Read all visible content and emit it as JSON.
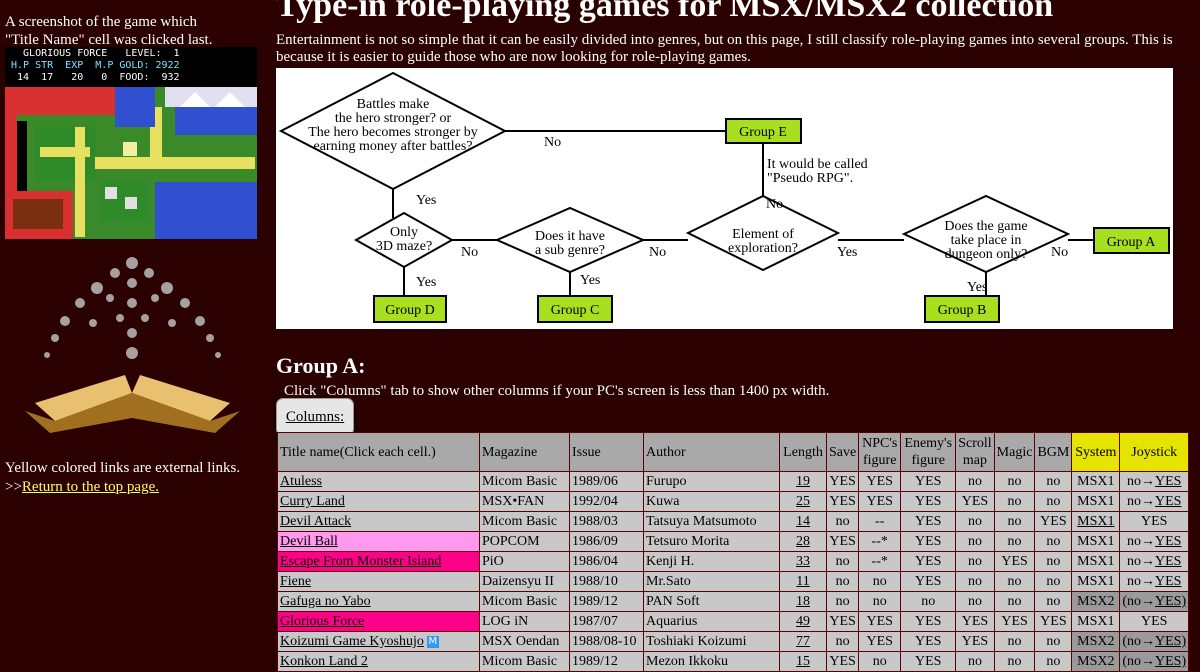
{
  "sidebar": {
    "caption_line1": "A screenshot of the game which",
    "caption_line2": "\"Title Name\" cell was clicked last.",
    "hud": {
      "line1": "  GLORIOUS FORCE   LEVEL:  1",
      "line2": "H.P STR  EXP  M.P GOLD: 2922",
      "line3": " 14  17   20   0  FOOD:  932"
    },
    "yellow_note": "Yellow colored links are external links.",
    "return_prefix": ">>",
    "return_link": "Return to the top page."
  },
  "page": {
    "title": "Type-in role-playing games for MSX/MSX2 collection",
    "intro": "Entertainment is not so simple that it can be easily divided into genres, but on this page, I still classify role-playing games into several groups. This is because it is easier to guide those who are now looking for role-playing games."
  },
  "flowchart": {
    "q1": [
      "Battles make",
      "the hero stronger? or",
      "The hero becomes stronger by",
      "earning money after battles?"
    ],
    "q2": [
      "Only",
      "3D maze?"
    ],
    "q3": [
      "Does it have",
      "a sub genre?"
    ],
    "q4": [
      "Element of",
      "exploration?"
    ],
    "q5": [
      "Does the game",
      "take place in",
      "dungeon only?"
    ],
    "yes": "Yes",
    "no": "No",
    "pseudo_note": [
      "It would be called",
      "\"Pseudo RPG\"."
    ],
    "groups": {
      "a": "Group A",
      "b": "Group B",
      "c": "Group C",
      "d": "Group D",
      "e": "Group E"
    }
  },
  "group_a": {
    "heading": "Group A:",
    "hint": "Click \"Columns\" tab to show other columns if your PC's screen is less than 1400 px width.",
    "columns_button": "Columns:"
  },
  "table": {
    "headers": {
      "title": "Title name(Click each cell.)",
      "magazine": "Magazine",
      "issue": "Issue",
      "author": "Author",
      "length": "Length",
      "save": "Save",
      "npc": "NPC's figure",
      "enemy": "Enemy's figure",
      "scroll": "Scroll map",
      "magic": "Magic",
      "bgm": "BGM",
      "system": "System",
      "joystick": "Joystick"
    },
    "rows": [
      {
        "title": "Atuless",
        "magazine": "Micom Basic",
        "issue": "1989/06",
        "author": "Furupo",
        "length": "19",
        "save": "YES",
        "npc": "YES",
        "enemy": "YES",
        "scroll": "no",
        "magic": "no",
        "bgm": "no",
        "system": "MSX1",
        "joy_a": "no→",
        "joy_b": "YES"
      },
      {
        "title": "Curry Land",
        "magazine": "MSX•FAN",
        "issue": "1992/04",
        "author": "Kuwa",
        "length": "25",
        "save": "YES",
        "npc": "YES",
        "enemy": "YES",
        "scroll": "YES",
        "magic": "no",
        "bgm": "no",
        "system": "MSX1",
        "joy_a": "no→",
        "joy_b": "YES"
      },
      {
        "title": "Devil Attack",
        "magazine": "Micom Basic",
        "issue": "1988/03",
        "author": "Tatsuya Matsumoto",
        "length": "14",
        "save": "no",
        "npc": "--",
        "enemy": "YES",
        "scroll": "no",
        "magic": "no",
        "bgm": "YES",
        "system": "MSX1",
        "joy_a": "",
        "joy_b": "YES"
      },
      {
        "title": "Devil Ball",
        "magazine": "POPCOM",
        "issue": "1986/09",
        "author": "Tetsuro Morita",
        "length": "28",
        "save": "YES",
        "npc": "--*",
        "enemy": "YES",
        "scroll": "no",
        "magic": "no",
        "bgm": "no",
        "system": "MSX1",
        "joy_a": "no→",
        "joy_b": "YES"
      },
      {
        "title": "Escape From Monster Island",
        "magazine": "PiO",
        "issue": "1986/04",
        "author": "Kenji H.",
        "length": "33",
        "save": "no",
        "npc": "--*",
        "enemy": "YES",
        "scroll": "no",
        "magic": "YES",
        "bgm": "no",
        "system": "MSX1",
        "joy_a": "no→",
        "joy_b": "YES"
      },
      {
        "title": "Fiene",
        "magazine": "Daizensyu II",
        "issue": "1988/10",
        "author": "Mr.Sato",
        "length": "11",
        "save": "no",
        "npc": "no",
        "enemy": "YES",
        "scroll": "no",
        "magic": "no",
        "bgm": "no",
        "system": "MSX1",
        "joy_a": "no→",
        "joy_b": "YES"
      },
      {
        "title": "Gafuga no Yabo",
        "magazine": "Micom Basic",
        "issue": "1989/12",
        "author": "PAN Soft",
        "length": "18",
        "save": "no",
        "npc": "no",
        "enemy": "no",
        "scroll": "no",
        "magic": "no",
        "bgm": "no",
        "system": "MSX2",
        "joy_a": "(no→",
        "joy_b": "YES)"
      },
      {
        "title": "Glorious Force",
        "magazine": "LOG iN",
        "issue": "1987/07",
        "author": "Aquarius",
        "length": "49",
        "save": "YES",
        "npc": "YES",
        "enemy": "YES",
        "scroll": "YES",
        "magic": "YES",
        "bgm": "YES",
        "system": "MSX1",
        "joy_a": "",
        "joy_b": "YES"
      },
      {
        "title": "Koizumi Game Kyoshujo",
        "magazine": "MSX Oendan",
        "issue": "1988/08-10",
        "author": "Toshiaki Koizumi",
        "length": "77",
        "save": "no",
        "npc": "YES",
        "enemy": "YES",
        "scroll": "YES",
        "magic": "no",
        "bgm": "no",
        "system": "MSX2",
        "joy_a": "(no→",
        "joy_b": "YES)"
      },
      {
        "title": "Konkon Land 2",
        "magazine": "Micom Basic",
        "issue": "1989/12",
        "author": "Mezon Ikkoku",
        "length": "15",
        "save": "YES",
        "npc": "no",
        "enemy": "YES",
        "scroll": "no",
        "magic": "no",
        "bgm": "no",
        "system": "MSX2",
        "joy_a": "(no→",
        "joy_b": "YES)"
      }
    ]
  },
  "colors": {
    "background": "#2a0000",
    "group_box": "#a8e020",
    "title_pink": "#ff99ee",
    "title_magenta": "#ff0088",
    "header_highlight": "#e4e400",
    "external_link": "#ffff66"
  }
}
